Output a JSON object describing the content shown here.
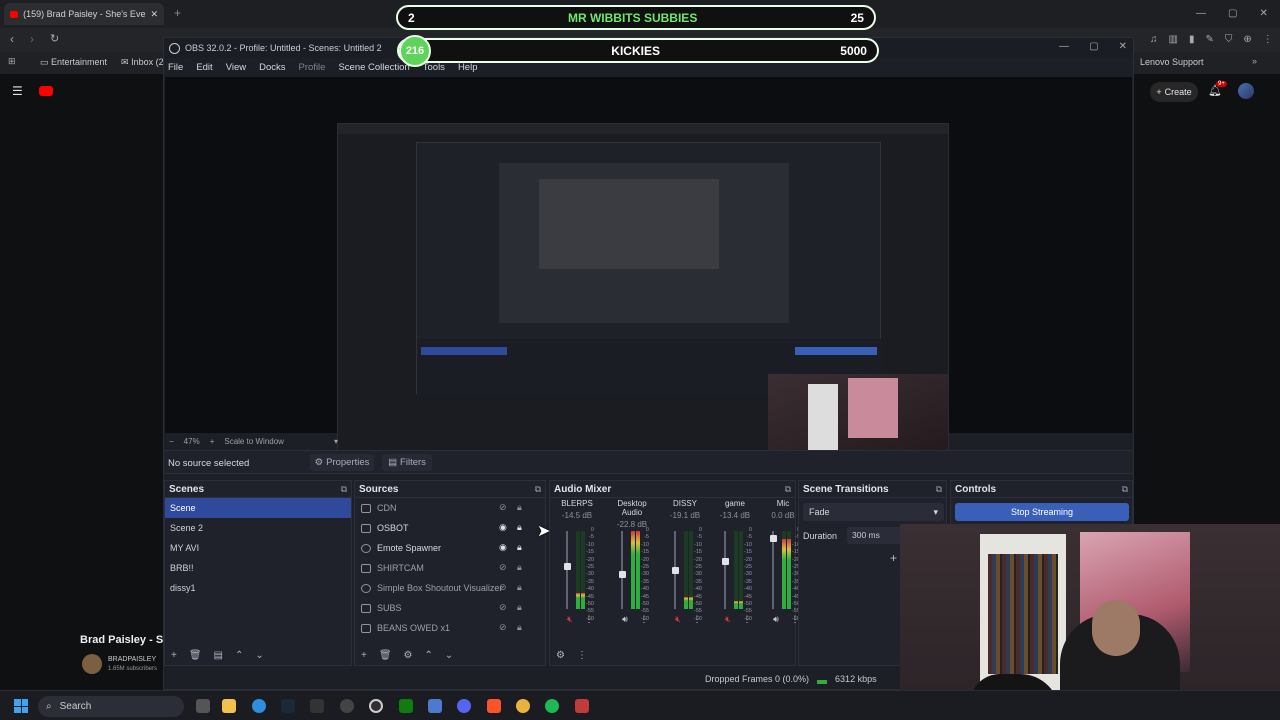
{
  "browser": {
    "tab_title": "(159) Brad Paisley - She's Eve",
    "bookmarks": [
      "Entertainment",
      "Inbox (2..."
    ],
    "bookmark_right": "Lenovo Support"
  },
  "youtube": {
    "create_label": "Create",
    "notif_count": "9+",
    "video_title": "Brad Paisley - Sh",
    "channel": "BRADPAISLEY",
    "subs": "1.65M subscribers"
  },
  "overlay": {
    "top": {
      "left_num": "2",
      "title": "MR WIBBITS SUBBIES",
      "right_num": "25"
    },
    "bottom": {
      "left_num": "216",
      "title": "KICKIES",
      "right_num": "5000"
    }
  },
  "obs": {
    "title": "OBS 32.0.2 - Profile: Untitled - Scenes: Untitled 2",
    "menu": [
      "File",
      "Edit",
      "View",
      "Docks",
      "Profile",
      "Scene Collection",
      "Tools",
      "Help"
    ],
    "zoom": "47%",
    "scale_mode": "Scale to Window",
    "no_source": "No source selected",
    "properties_label": "Properties",
    "filters_label": "Filters",
    "scenes_title": "Scenes",
    "scenes": [
      "Scene",
      "Scene 2",
      "MY AVI",
      "BRB!!",
      "dissy1"
    ],
    "selected_scene": "Scene",
    "sources_title": "Sources",
    "sources": [
      {
        "name": "CDN",
        "visible": false
      },
      {
        "name": "OSBOT",
        "visible": true
      },
      {
        "name": "Emote Spawner",
        "visible": true
      },
      {
        "name": "SHIRTCAM",
        "visible": false
      },
      {
        "name": "Simple Box Shoutout Visualizer",
        "visible": false
      },
      {
        "name": "SUBS",
        "visible": false
      },
      {
        "name": "BEANS OWED x1",
        "visible": false
      }
    ],
    "mixer_title": "Audio Mixer",
    "channels": [
      {
        "name": "BLERPS",
        "db": "-14.5 dB",
        "level": 0.2,
        "fader": 0.55,
        "muted": true
      },
      {
        "name": "Desktop Audio",
        "db": "-22.8 dB",
        "level": 1.0,
        "fader": 0.45,
        "muted": false
      },
      {
        "name": "DISSY",
        "db": "-19.1 dB",
        "level": 0.15,
        "fader": 0.5,
        "muted": true
      },
      {
        "name": "game",
        "db": "-13.4 dB",
        "level": 0.1,
        "fader": 0.62,
        "muted": true
      },
      {
        "name": "Mic",
        "db": "0.0 dB",
        "level": 0.9,
        "fader": 0.95,
        "muted": false
      }
    ],
    "meter_ticks": [
      "0",
      "-5",
      "-10",
      "-15",
      "-20",
      "-25",
      "-30",
      "-35",
      "-40",
      "-45",
      "-50",
      "-55",
      "-60"
    ],
    "transitions_title": "Scene Transitions",
    "transition": "Fade",
    "duration_label": "Duration",
    "duration": "300 ms",
    "controls_title": "Controls",
    "stop_streaming": "Stop Streaming",
    "dropped_frames": "Dropped Frames 0 (0.0%)",
    "kbps": "6312 kbps"
  },
  "taskbar": {
    "search": "Search"
  },
  "colors": {
    "accent": "#3a5fb8",
    "overlay_green": "#5fd35a"
  }
}
